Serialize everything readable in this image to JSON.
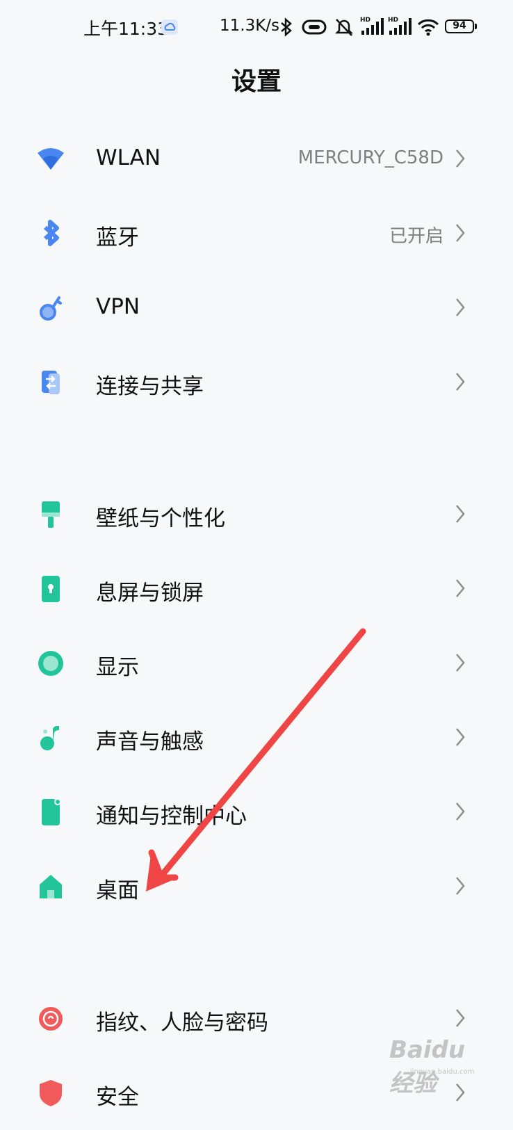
{
  "status_bar": {
    "time": "上午11:33",
    "net_speed": "11.3K/s",
    "battery": "94",
    "icons": [
      "cloud-sync-icon",
      "bluetooth-icon",
      "nfc-icon",
      "mute-icon",
      "signal-hd-icon",
      "signal-hd-icon",
      "wifi-icon",
      "battery-icon"
    ],
    "hd_label": "HD"
  },
  "header": {
    "title": "设置"
  },
  "sections": [
    {
      "items": [
        {
          "label": "WLAN",
          "value": "MERCURY_C58D",
          "icon": "wifi-icon",
          "color": "#4a86f0"
        },
        {
          "label": "蓝牙",
          "value": "已开启",
          "icon": "bluetooth-icon",
          "color": "#4a86f0"
        },
        {
          "label": "VPN",
          "value": "",
          "icon": "vpn-key-icon",
          "color": "#4a86f0"
        },
        {
          "label": "连接与共享",
          "value": "",
          "icon": "share-icon",
          "color": "#4a86f0"
        }
      ]
    },
    {
      "items": [
        {
          "label": "壁纸与个性化",
          "value": "",
          "icon": "brush-icon",
          "color": "#22c49a"
        },
        {
          "label": "息屏与锁屏",
          "value": "",
          "icon": "lock-icon",
          "color": "#22c49a"
        },
        {
          "label": "显示",
          "value": "",
          "icon": "display-icon",
          "color": "#22c49a"
        },
        {
          "label": "声音与触感",
          "value": "",
          "icon": "music-note-icon",
          "color": "#22c49a"
        },
        {
          "label": "通知与控制中心",
          "value": "",
          "icon": "notification-icon",
          "color": "#22c49a"
        },
        {
          "label": "桌面",
          "value": "",
          "icon": "home-icon",
          "color": "#22c49a"
        }
      ]
    },
    {
      "items": [
        {
          "label": "指纹、人脸与密码",
          "value": "",
          "icon": "fingerprint-icon",
          "color": "#f05a5a"
        },
        {
          "label": "安全",
          "value": "",
          "icon": "shield-icon",
          "color": "#f05a5a"
        }
      ]
    }
  ],
  "annotation": {
    "type": "arrow",
    "color": "#f04545",
    "target": "桌面"
  },
  "watermark": {
    "text": "Baidu经验",
    "sub": "jingyan.baidu.com"
  }
}
